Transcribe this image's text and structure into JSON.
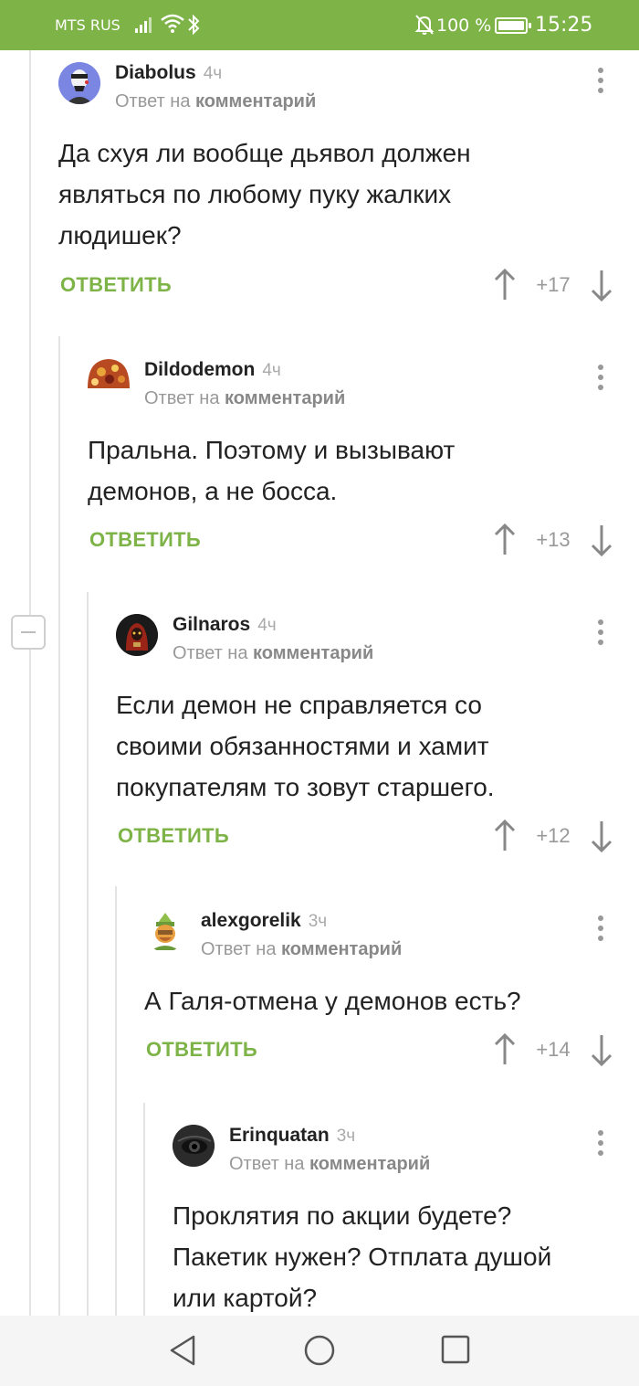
{
  "status_bar": {
    "carrier": "MTS RUS",
    "battery": "100 %",
    "time": "15:25"
  },
  "comments": [
    {
      "author": "Diabolus",
      "time": "4ч",
      "reply_prefix": "Ответ на",
      "reply_target": "комментарий",
      "lines": [
        "Да схуя ли вообще дьявол должен",
        "являться по любому пуку жалких",
        "людишек?"
      ],
      "reply_label": "ОТВЕТИТЬ",
      "score": "+17"
    },
    {
      "author": "Dildodemon",
      "time": "4ч",
      "reply_prefix": "Ответ на",
      "reply_target": "комментарий",
      "lines": [
        "Пральна. Поэтому и вызывают",
        "демонов, а не босса."
      ],
      "reply_label": "ОТВЕТИТЬ",
      "score": "+13"
    },
    {
      "author": "Gilnaros",
      "time": "4ч",
      "reply_prefix": "Ответ на",
      "reply_target": "комментарий",
      "lines": [
        "Если демон не справляется со",
        "своими обязанностями и хамит",
        "покупателям то зовут старшего."
      ],
      "reply_label": "ОТВЕТИТЬ",
      "score": "+12"
    },
    {
      "author": "alexgorelik",
      "time": "3ч",
      "reply_prefix": "Ответ на",
      "reply_target": "комментарий",
      "lines": [
        "А Галя-отмена у демонов есть?"
      ],
      "reply_label": "ОТВЕТИТЬ",
      "score": "+14"
    },
    {
      "author": "Erinquatan",
      "time": "3ч",
      "reply_prefix": "Ответ на",
      "reply_target": "комментарий",
      "lines": [
        "Проклятия по акции будете?",
        "Пакетик нужен? Отплата душой",
        "или картой?"
      ]
    }
  ],
  "colors": {
    "accent": "#7db347",
    "muted": "#999999",
    "thread_line": "#e3e3e3"
  }
}
